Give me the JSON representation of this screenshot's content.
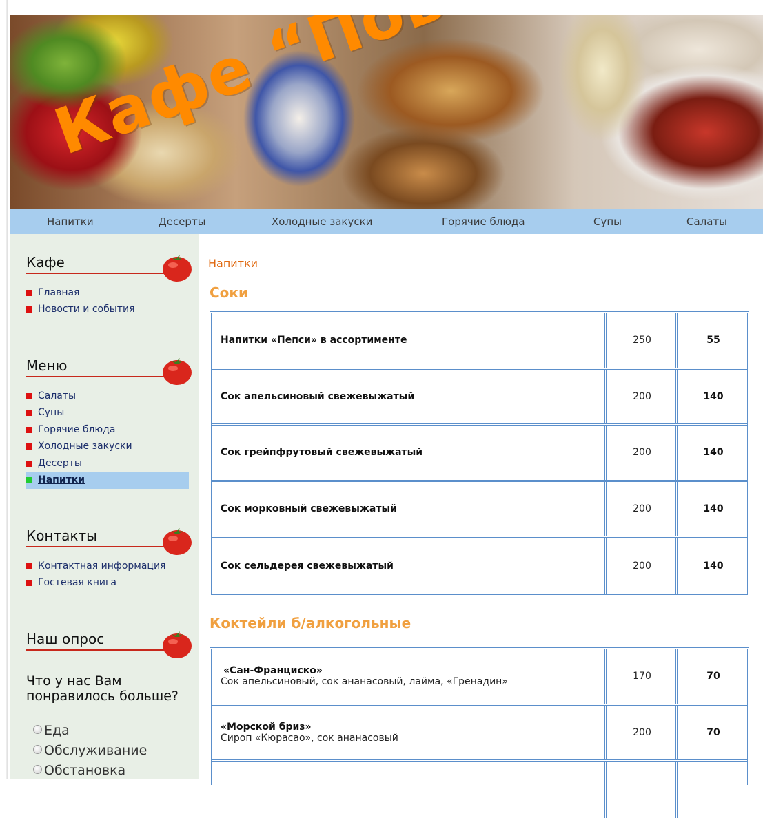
{
  "header": {
    "title": "Кафе “Поворот”"
  },
  "topnav": {
    "items": [
      {
        "label": "Напитки"
      },
      {
        "label": "Десерты"
      },
      {
        "label": "Холодные закуски"
      },
      {
        "label": "Горячие блюда"
      },
      {
        "label": "Супы"
      },
      {
        "label": "Салаты"
      }
    ]
  },
  "sidebar": {
    "cafe": {
      "heading": "Кафе",
      "items": [
        {
          "label": "Главная"
        },
        {
          "label": "Новости и события"
        }
      ]
    },
    "menu": {
      "heading": "Меню",
      "items": [
        {
          "label": "Салаты"
        },
        {
          "label": "Супы"
        },
        {
          "label": "Горячие блюда"
        },
        {
          "label": "Холодные закуски"
        },
        {
          "label": "Десерты"
        },
        {
          "label": "Напитки",
          "active": true
        }
      ]
    },
    "contacts": {
      "heading": "Контакты",
      "items": [
        {
          "label": "Контактная информация"
        },
        {
          "label": "Гостевая книга"
        }
      ]
    },
    "poll": {
      "heading": "Наш опрос",
      "question": "Что у нас Вам понравилось больше?",
      "options": [
        {
          "label": "Еда"
        },
        {
          "label": "Обслуживание"
        },
        {
          "label": "Обстановка"
        }
      ]
    }
  },
  "main": {
    "breadcrumb": "Напитки",
    "sections": [
      {
        "title": "Соки",
        "rows": [
          {
            "name": "Напитки «Пепси» в ассортименте",
            "desc": "",
            "volume": "250",
            "price": "55"
          },
          {
            "name": "Сок апельсиновый свежевыжатый",
            "desc": "",
            "volume": "200",
            "price": "140"
          },
          {
            "name": "Сок грейпфрутовый свежевыжатый",
            "desc": "",
            "volume": "200",
            "price": "140"
          },
          {
            "name": "Сок морковный свежевыжатый",
            "desc": "",
            "volume": "200",
            "price": "140"
          },
          {
            "name": "Сок сельдерея свежевыжатый",
            "desc": "",
            "volume": "200",
            "price": "140"
          }
        ]
      },
      {
        "title": "Коктейли б/алкогольные",
        "rows": [
          {
            "name": "«Сан-Франциско»",
            "desc": "Сок апельсиновый, сок ананасовый, лайма, «Гренадин»",
            "volume": "170",
            "price": "70"
          },
          {
            "name": "«Морской бриз»",
            "desc": "Сироп «Кюрасао», сок ананасовый",
            "volume": "200",
            "price": "70"
          },
          {
            "name": "",
            "desc": "",
            "volume": "",
            "price": ""
          }
        ]
      }
    ]
  },
  "colors": {
    "accent": "#ff8a00",
    "nav_bg": "#a7cdee",
    "sidebar_bg": "#e8efe6",
    "table_border": "#5b8fcb",
    "bullet": "#dd1111",
    "active_bullet": "#22cc33"
  }
}
